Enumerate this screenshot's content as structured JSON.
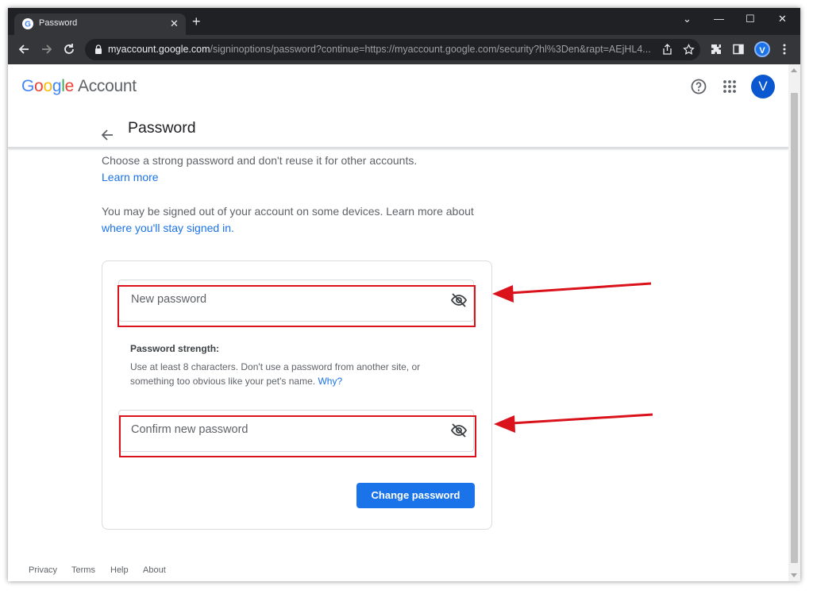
{
  "browser": {
    "tab_title": "Password",
    "tab_close": "✕",
    "new_tab": "+",
    "window_controls": {
      "minimize_menu": "⌄",
      "minimize": "—",
      "maximize": "☐",
      "close": "✕"
    },
    "url_host": "myaccount.google.com",
    "url_path": "/signinoptions/password?continue=https://myaccount.google.com/security?hl%3Den&rapt=AEjHL4...",
    "profile_initial": "V"
  },
  "header": {
    "logo_google": [
      "G",
      "o",
      "o",
      "g",
      "l",
      "e"
    ],
    "logo_colors": [
      "#4285f4",
      "#ea4335",
      "#fbbc05",
      "#4285f4",
      "#34a853",
      "#ea4335"
    ],
    "logo_account": "Account",
    "avatar_initial": "V"
  },
  "page": {
    "title": "Password",
    "intro1_text": "Choose a strong password and don't reuse it for other accounts.",
    "intro1_link": "Learn more",
    "intro2_text": "You may be signed out of your account on some devices. Learn more about",
    "intro2_link": "where you'll stay signed in."
  },
  "form": {
    "new_password_label": "New password",
    "strength_title": "Password strength:",
    "strength_text": "Use at least 8 characters. Don't use a password from another site, or something too obvious like your pet's name.",
    "strength_link": "Why?",
    "confirm_password_label": "Confirm new password",
    "submit_label": "Change password"
  },
  "footer": {
    "links": [
      "Privacy",
      "Terms",
      "Help",
      "About"
    ]
  },
  "colors": {
    "accent": "#1a73e8",
    "annotation_red": "#d9121b"
  }
}
